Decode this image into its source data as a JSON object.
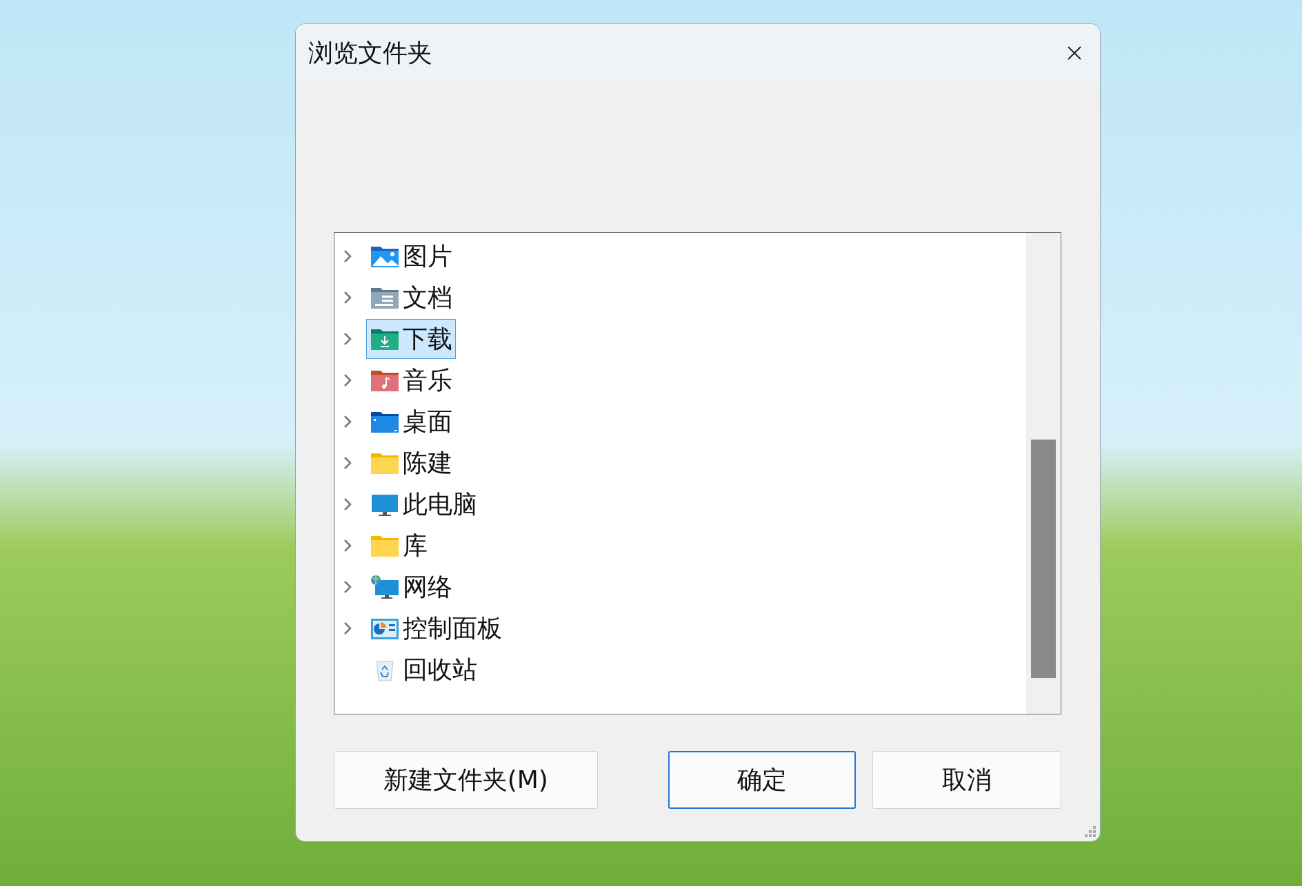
{
  "window": {
    "title": "浏览文件夹"
  },
  "tree": {
    "items": [
      {
        "label": "图片",
        "kind": "pictures",
        "has_children": true,
        "selected": false
      },
      {
        "label": "文档",
        "kind": "documents",
        "has_children": true,
        "selected": false
      },
      {
        "label": "下载",
        "kind": "downloads",
        "has_children": true,
        "selected": true
      },
      {
        "label": "音乐",
        "kind": "music",
        "has_children": true,
        "selected": false
      },
      {
        "label": "桌面",
        "kind": "desktop",
        "has_children": true,
        "selected": false
      },
      {
        "label": "陈建",
        "kind": "folder",
        "has_children": true,
        "selected": false
      },
      {
        "label": "此电脑",
        "kind": "computer",
        "has_children": true,
        "selected": false
      },
      {
        "label": "库",
        "kind": "folder",
        "has_children": true,
        "selected": false
      },
      {
        "label": "网络",
        "kind": "network",
        "has_children": true,
        "selected": false
      },
      {
        "label": "控制面板",
        "kind": "control_panel",
        "has_children": true,
        "selected": false
      },
      {
        "label": "回收站",
        "kind": "recycle_bin",
        "has_children": false,
        "selected": false
      }
    ]
  },
  "buttons": [
    {
      "label": "新建文件夹(M)",
      "kind": "new_folder",
      "default": false
    },
    {
      "label": "确定",
      "kind": "ok",
      "default": true
    },
    {
      "label": "取消",
      "kind": "cancel",
      "default": false
    }
  ]
}
